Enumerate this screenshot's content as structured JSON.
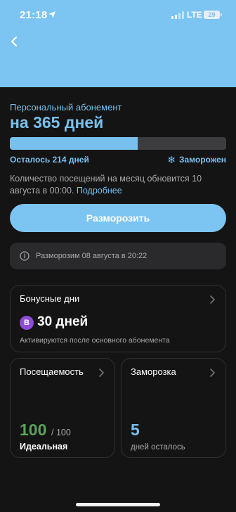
{
  "status_bar": {
    "time": "21:18",
    "network": "LTE",
    "battery": "29"
  },
  "subscription": {
    "label": "Персональный абонемент",
    "title": "на 365 дней",
    "progress_fraction": 0.59,
    "remaining_text": "Осталось 214 дней",
    "frozen_text": "Заморожен",
    "info_text": "Количество посещений на месяц обновится 10 августа в 00:00.",
    "info_link": "Подробнее",
    "unfreeze_button": "Разморозить",
    "notice_text": "Разморозим 08 августа в 20:22"
  },
  "bonus": {
    "title": "Бонусные дни",
    "badge": "B",
    "value": "30 дней",
    "subtitle": "Активируются после основного абонемента"
  },
  "attendance": {
    "title": "Посещаемость",
    "value": "100",
    "total": "/ 100",
    "status": "Идеальная"
  },
  "freeze": {
    "title": "Заморозка",
    "value": "5",
    "subtitle": "дней осталось"
  },
  "colors": {
    "accent": "#78c0ee",
    "header": "#7cc4f2",
    "success": "#5aa35a",
    "bonus_badge": "#8e4bd6",
    "background": "#141414"
  }
}
